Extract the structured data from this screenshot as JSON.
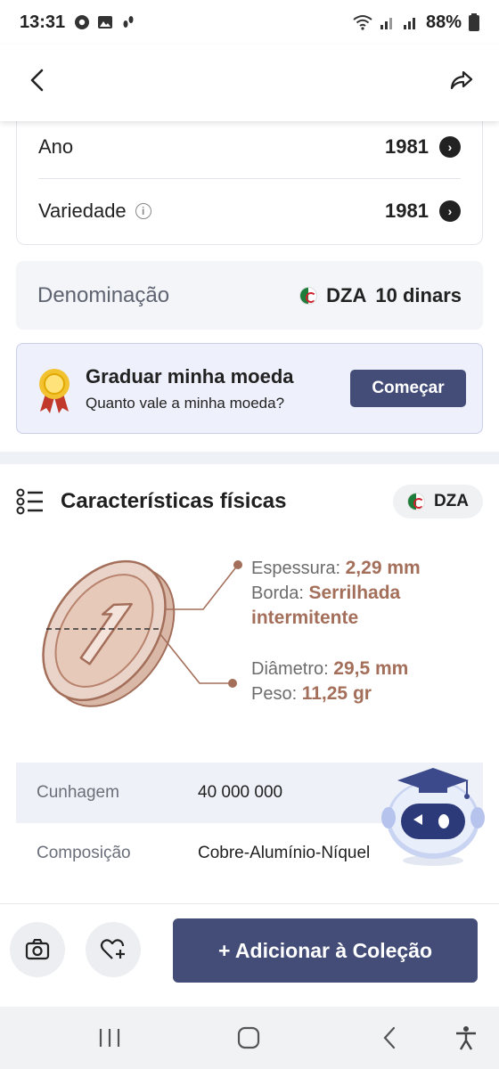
{
  "status_bar": {
    "time": "13:31",
    "battery": "88%"
  },
  "details": {
    "ano": {
      "label": "Ano",
      "value": "1981"
    },
    "variedade": {
      "label": "Variedade",
      "value": "1981"
    }
  },
  "denomination": {
    "label": "Denominação",
    "country_code": "DZA",
    "value": "10 dinars"
  },
  "grade_card": {
    "title": "Graduar minha moeda",
    "subtitle": "Quanto vale a minha moeda?",
    "button": "Começar"
  },
  "physical": {
    "title": "Características físicas",
    "country_code": "DZA",
    "thickness_label": "Espessura:",
    "thickness_value": "2,29 mm",
    "edge_label": "Borda:",
    "edge_value_1": "Serrilhada",
    "edge_value_2": "intermitente",
    "diameter_label": "Diâmetro:",
    "diameter_value": "29,5 mm",
    "weight_label": "Peso:",
    "weight_value": "11,25 gr"
  },
  "table": [
    {
      "key": "Cunhagem",
      "value": "40 000 000"
    },
    {
      "key": "Composição",
      "value": "Cobre-Alumínio-Níquel"
    }
  ],
  "bottom": {
    "add_button": "+ Adicionar à Coleção"
  },
  "colors": {
    "accent": "#434d78",
    "coin": "#a46f5a",
    "flag_green": "#1e7d3a",
    "flag_red": "#d21f2e"
  }
}
